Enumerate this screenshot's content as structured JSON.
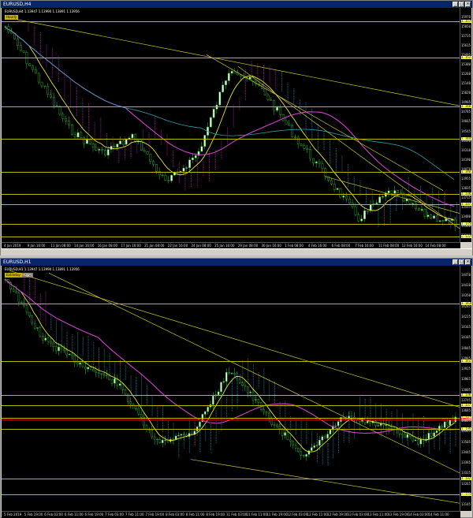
{
  "windows": [
    {
      "title": "EURUSD,H4",
      "header": "EURUSD,H4  1.13947 1.13990 1.13891 1.13956",
      "badges": [
        "Hourly"
      ],
      "price_labels": [
        "1.15970",
        "1.15850",
        "1.15735",
        "1.15615",
        "1.15495",
        "1.15380",
        "1.15260",
        "1.15140",
        "1.15020",
        "1.14905",
        "1.14785",
        "1.14665",
        "1.14545",
        "1.14430",
        "1.14310",
        "1.14190",
        "1.14070",
        "1.13955",
        "1.13835",
        "1.13715",
        "1.13595",
        "1.13480",
        "1.13360",
        "1.13240"
      ],
      "level_tags": [
        "1.15780",
        "1.15270",
        "1.14810",
        "1.14450",
        "1.14072",
        "1.13820",
        "1.13770",
        "1.13500",
        "1.13290"
      ],
      "time_labels": [
        "4 Jan 2019",
        "9 Jan 16:00",
        "11 Jan 08:00",
        "14 Jan 16:00",
        "16 Jan 08:00",
        "17 Jan 16:00",
        "21 Jan 08:00",
        "22 Jan 16:00",
        "24 Jan 08:00",
        "25 Jan 16:00",
        "29 Jan 08:00",
        "30 Jan 16:00",
        "1 Feb 08:00",
        "4 Feb 16:00",
        "6 Feb 08:00",
        "7 Feb 16:00",
        "11 Feb 08:00",
        "12 Feb 16:00",
        "14 Feb 08:00"
      ]
    },
    {
      "title": "EURUSD,H1",
      "header": "EURUSD,H1  1.13947 1.13990 1.13891 1.13956",
      "badges": [
        "Extraday",
        "Kijun"
      ],
      "price_labels": [
        "1.14470",
        "1.14410",
        "1.14350",
        "1.14285",
        "1.14225",
        "1.14165",
        "1.14105",
        "1.14045",
        "1.13985",
        "1.13925",
        "1.13865",
        "1.13805",
        "1.13745",
        "1.13685",
        "1.13625",
        "1.13565",
        "1.13505",
        "1.13445",
        "1.13385",
        "1.13325",
        "1.13265",
        "1.13205",
        "1.13145"
      ],
      "level_tags": [
        "1.14380",
        "1.14150",
        "1.13870",
        "1.13775",
        "1.13745",
        "1.13650",
        "1.13255",
        "1.13160"
      ],
      "current_price": "1.13956",
      "time_labels": [
        "5 Feb 2019",
        "5 Feb 19:00",
        "6 Feb 03:00",
        "6 Feb 11:00",
        "6 Feb 19:00",
        "7 Feb 03:00",
        "7 Feb 11:00",
        "7 Feb 19:00",
        "8 Feb 03:00",
        "8 Feb 11:00",
        "8 Feb 19:00",
        "11 Feb 03:00",
        "11 Feb 11:00",
        "11 Feb 19:00",
        "12 Feb 03:00",
        "12 Feb 11:00",
        "12 Feb 19:00",
        "13 Feb 03:00",
        "13 Feb 11:00",
        "13 Feb 19:00",
        "14 Feb 03:00",
        "14 Feb 11:00"
      ]
    }
  ]
}
